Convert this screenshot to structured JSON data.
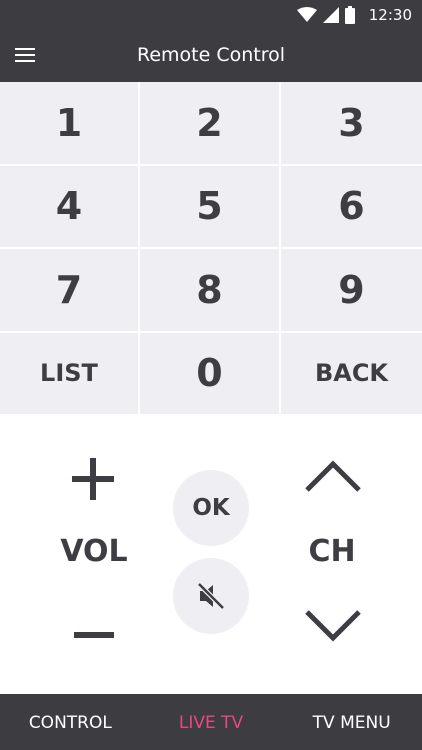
{
  "status_bar": {
    "time": "12:30"
  },
  "app_bar": {
    "title": "Remote Control"
  },
  "keypad": {
    "keys": [
      "1",
      "2",
      "3",
      "4",
      "5",
      "6",
      "7",
      "8",
      "9",
      "LIST",
      "0",
      "BACK"
    ]
  },
  "controls": {
    "vol_label": "VOL",
    "ok_label": "OK",
    "ch_label": "CH"
  },
  "bottom_nav": {
    "items": [
      "CONTROL",
      "LIVE TV",
      "TV MENU"
    ],
    "active": "LIVE TV",
    "active_color": "#e8497e"
  },
  "colors": {
    "bar_bg": "#3d3c41",
    "key_bg": "#efeef3",
    "text_dark": "#3e3d43"
  }
}
